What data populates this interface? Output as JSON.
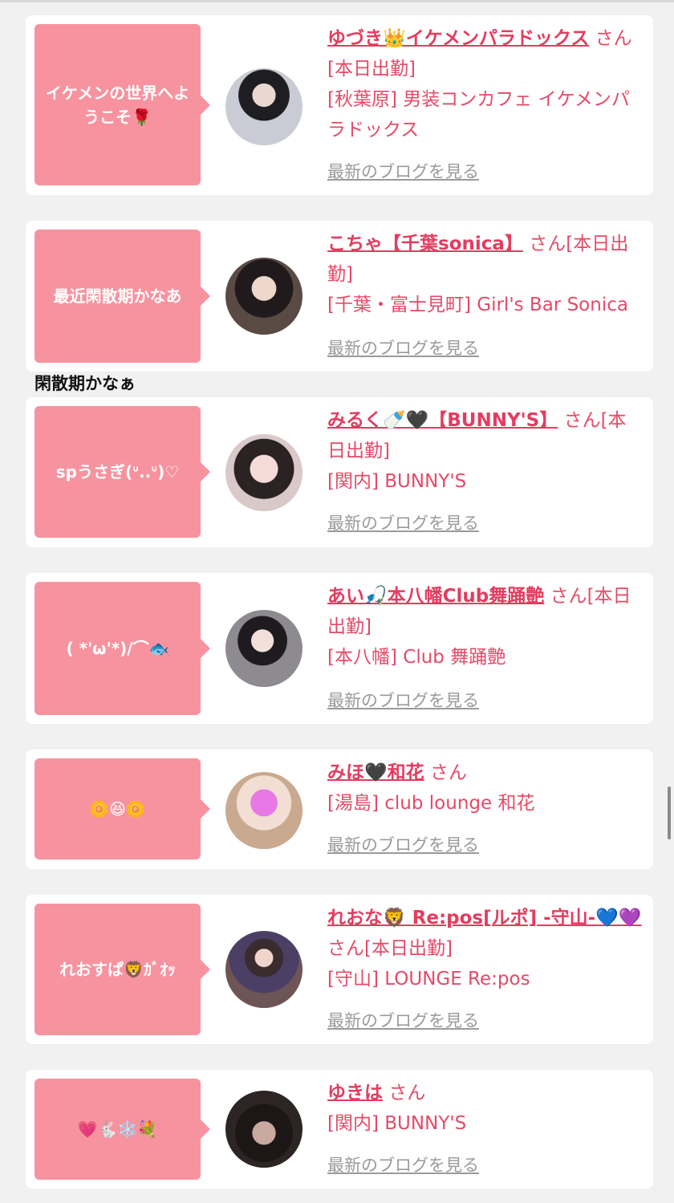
{
  "section_heading": "閑散期かなぁ",
  "blog_link_label": "最新のブログを見る",
  "entries": [
    {
      "bubble": "イケメンの世界へようこそ🌹",
      "name": "ゆづき👑イケメンパラドックス",
      "suffix": "さん[本日出勤]",
      "shop": "[秋葉原] 男装コンカフェ イケメンパラドックス"
    },
    {
      "bubble": "最近閑散期かなあ",
      "name": "こちゃ【千葉sonica】",
      "suffix": "さん[本日出勤]",
      "shop": "[千葉・富士見町] Girl's Bar Sonica"
    },
    {
      "bubble": "spうさぎ(ᐡ..ᐡ)♡",
      "name": "みるく🍼🖤【BUNNY'S】",
      "suffix": "さん[本日出勤]",
      "shop": "[関内] BUNNY'S"
    },
    {
      "bubble": "( *'ω'*)/⌒🐟",
      "name": "あい🎣本八幡Club舞踊艶",
      "suffix": "さん[本日出勤]",
      "shop": "[本八幡] Club 舞踊艶"
    },
    {
      "bubble": "🌼😆🌼",
      "name": "みほ🖤和花",
      "suffix": "さん",
      "shop": "[湯島] club lounge 和花"
    },
    {
      "bubble": "れおすぱ🦁ｶﾞｵｯ",
      "name": "れおな🦁 Re:pos[ルポ] -守山-💙💜",
      "suffix": "さん[本日出勤]",
      "shop": "[守山] LOUNGE Re:pos"
    },
    {
      "bubble": "💗🐇❄️💐",
      "name": "ゆきは",
      "suffix": "さん",
      "shop": "[関内] BUNNY'S"
    }
  ]
}
